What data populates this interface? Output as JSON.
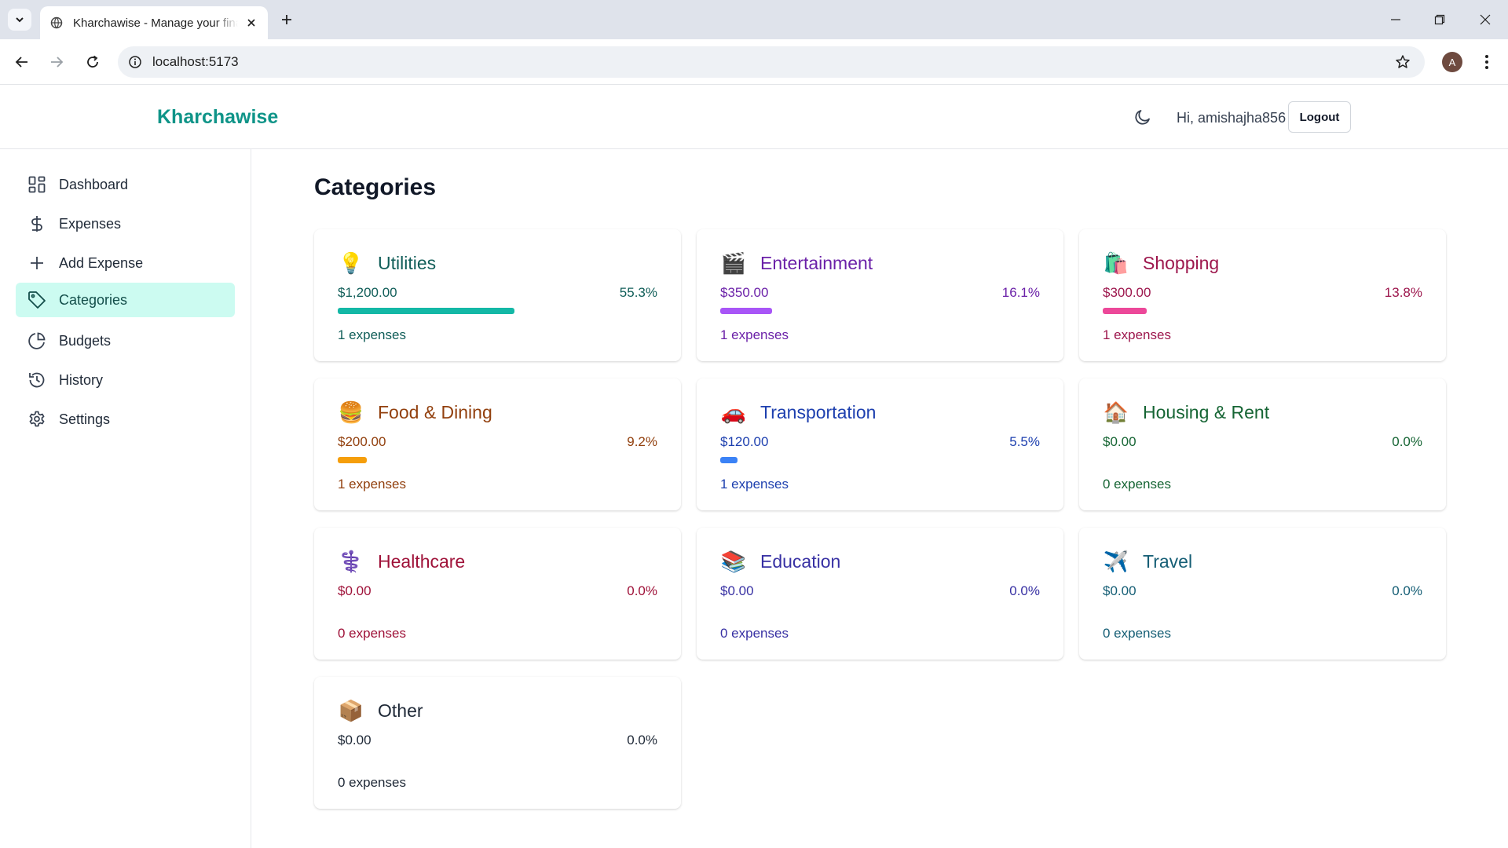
{
  "browser": {
    "tab_title": "Kharchawise - Manage your finances",
    "url": "localhost:5173",
    "profile_initial": "A"
  },
  "header": {
    "brand": "Kharchawise",
    "greeting": "Hi, amishajha856",
    "logout_label": "Logout"
  },
  "sidebar": {
    "items": [
      {
        "label": "Dashboard",
        "icon": "dashboard-grid-icon",
        "active": false
      },
      {
        "label": "Expenses",
        "icon": "dollar-icon",
        "active": false
      },
      {
        "label": "Add Expense",
        "icon": "plus-icon",
        "active": false
      },
      {
        "label": "Categories",
        "icon": "tag-icon",
        "active": true
      },
      {
        "label": "Budgets",
        "icon": "pie-chart-icon",
        "active": false
      },
      {
        "label": "History",
        "icon": "history-icon",
        "active": false
      },
      {
        "label": "Settings",
        "icon": "gear-icon",
        "active": false
      }
    ]
  },
  "page": {
    "title": "Categories"
  },
  "categories": [
    {
      "name": "Utilities",
      "emoji": "💡",
      "amount": "$1,200.00",
      "percent": "55.3%",
      "share": 0.553,
      "count": "1 expenses",
      "color": "#115e59",
      "bar_color": "#14b8a6"
    },
    {
      "name": "Entertainment",
      "emoji": "🎬",
      "amount": "$350.00",
      "percent": "16.1%",
      "share": 0.161,
      "count": "1 expenses",
      "color": "#6b21a8",
      "bar_color": "#a855f7"
    },
    {
      "name": "Shopping",
      "emoji": "🛍️",
      "amount": "$300.00",
      "percent": "13.8%",
      "share": 0.138,
      "count": "1 expenses",
      "color": "#9d174d",
      "bar_color": "#ec4899"
    },
    {
      "name": "Food & Dining",
      "emoji": "🍔",
      "amount": "$200.00",
      "percent": "9.2%",
      "share": 0.092,
      "count": "1 expenses",
      "color": "#92400e",
      "bar_color": "#f59e0b"
    },
    {
      "name": "Transportation",
      "emoji": "🚗",
      "amount": "$120.00",
      "percent": "5.5%",
      "share": 0.055,
      "count": "1 expenses",
      "color": "#1e40af",
      "bar_color": "#3b82f6"
    },
    {
      "name": "Housing & Rent",
      "emoji": "🏠",
      "amount": "$0.00",
      "percent": "0.0%",
      "share": 0,
      "count": "0 expenses",
      "color": "#166534",
      "bar_color": "#22c55e"
    },
    {
      "name": "Healthcare",
      "emoji": "⚕️",
      "amount": "$0.00",
      "percent": "0.0%",
      "share": 0,
      "count": "0 expenses",
      "color": "#9f1239",
      "bar_color": "#f43f5e"
    },
    {
      "name": "Education",
      "emoji": "📚",
      "amount": "$0.00",
      "percent": "0.0%",
      "share": 0,
      "count": "0 expenses",
      "color": "#3730a3",
      "bar_color": "#6366f1"
    },
    {
      "name": "Travel",
      "emoji": "✈️",
      "amount": "$0.00",
      "percent": "0.0%",
      "share": 0,
      "count": "0 expenses",
      "color": "#155e75",
      "bar_color": "#06b6d4"
    },
    {
      "name": "Other",
      "emoji": "📦",
      "amount": "$0.00",
      "percent": "0.0%",
      "share": 0,
      "count": "0 expenses",
      "color": "#1f2937",
      "bar_color": "#6b7280"
    }
  ]
}
